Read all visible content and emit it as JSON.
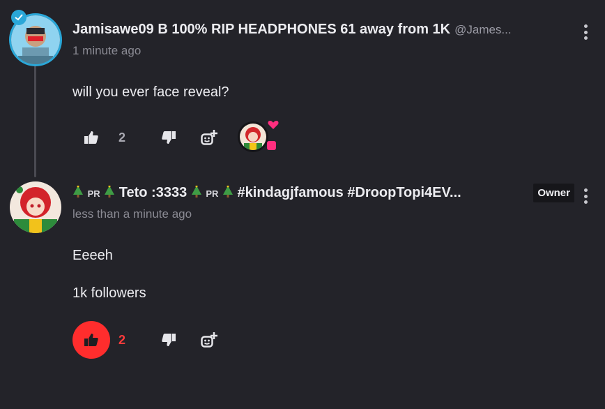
{
  "comments": [
    {
      "username": "Jamisawe09 B 100% RIP HEADPHONES 61 away from 1K",
      "handle": "@James...",
      "timestamp": "1 minute ago",
      "body": [
        "will you ever face reveal?"
      ],
      "like_count": "2",
      "liked": false,
      "creator_heart": true
    },
    {
      "username_parts": [
        "PR",
        "Teto :3333",
        "PR",
        "#kindagjfamous #DroopTopi4EV..."
      ],
      "badge": "Owner",
      "timestamp": "less than a minute ago",
      "body": [
        "Eeeeh",
        "1k followers"
      ],
      "like_count": "2",
      "liked": true
    }
  ],
  "colors": {
    "background": "#232329",
    "like_active": "#ff2d2d",
    "heart": "#ff2e7e",
    "avatar_ring": "#2aa7d8"
  },
  "icons": [
    "thumbs-up-icon",
    "thumbs-down-icon",
    "add-reply-icon",
    "more-vertical-icon",
    "heart-icon",
    "christmas-tree-icon"
  ]
}
